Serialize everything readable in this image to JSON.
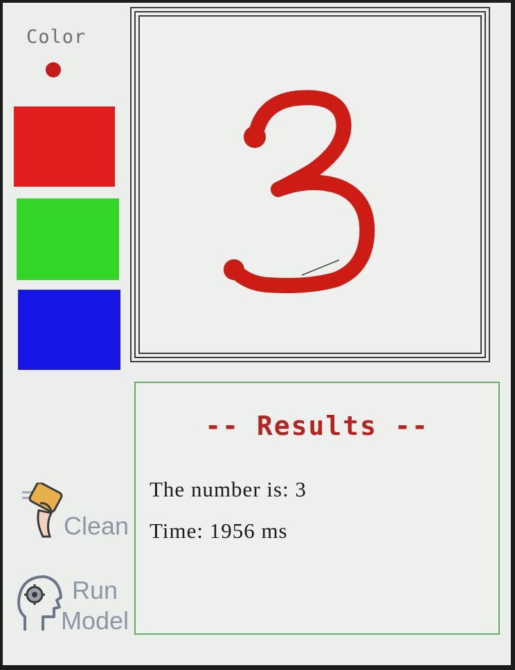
{
  "sidebar": {
    "color_label": "Color",
    "selected_color": "#c41a1a",
    "swatches": [
      {
        "name": "red",
        "color": "#e01e1e"
      },
      {
        "name": "green",
        "color": "#33d626"
      },
      {
        "name": "blue",
        "color": "#1616e6"
      }
    ],
    "clean_label": "Clean",
    "clean_icon": "eraser-hand-icon",
    "run_label_1": "Run",
    "run_label_2": "Model",
    "run_icon": "brain-gear-icon"
  },
  "canvas": {
    "drawn_digit": "3",
    "stroke_color": "#cc1c14"
  },
  "results": {
    "title": "-- Results --",
    "number_line": "The number is: 3",
    "time_line": "Time: 1956 ms"
  }
}
